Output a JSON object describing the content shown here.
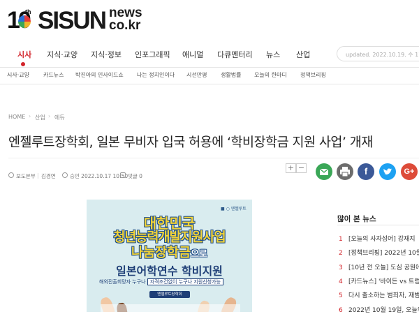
{
  "logo": {
    "ten": "10",
    "th": "th",
    "sisun": "SISUN",
    "news": "news",
    "cokr": "co.kr"
  },
  "main_nav": [
    "시사",
    "지식·교양",
    "지식·정보",
    "인포그래픽",
    "애니멀",
    "다큐멘터리",
    "뉴스",
    "산업"
  ],
  "updated": "updated. 2022.10.19. 수 17:30",
  "sub_nav": [
    "시사·교양",
    "카드뉴스",
    "박진아의 인사이드쇼",
    "나는 정치인이다",
    "시선만평",
    "생활법률",
    "오늘의 한마디",
    "정책브리핑"
  ],
  "breadcrumb": [
    "HOME",
    "산업",
    "에듀"
  ],
  "headline": "엔젤루트장학회, 일본 무비자 입국 허용에 ‘학비장학금 지원 사업’ 개재",
  "meta": {
    "author": "보도본부",
    "reporter": "김경연",
    "date": "승인 2022.10.17 10:50",
    "comments": "댓글 0"
  },
  "font_buttons": {
    "plus": "+",
    "minus": "−"
  },
  "share_icons": [
    {
      "name": "email-icon",
      "color": "#3aa757"
    },
    {
      "name": "print-icon",
      "color": "#6d6d6d"
    },
    {
      "name": "facebook-icon",
      "color": "#3b5998"
    },
    {
      "name": "twitter-icon",
      "color": "#1da1f2"
    },
    {
      "name": "google-plus-icon",
      "color": "#dd4b39"
    }
  ],
  "poster": {
    "logos": "■ ○ 엔젤루트",
    "line1": "대한민국",
    "line2": "청년능력개발지원사업",
    "line3": "나눔장학금",
    "line3_suffix": "으로",
    "line4": "일본어학연수 학비지원",
    "pill_left": "해외진출희망자 누구나",
    "pill_right": "자격조건없이 누구나 지원신청가능",
    "pill_bottom": "엔젤루트장학회"
  },
  "sidebar": {
    "title": "많이 본 뉴스",
    "items": [
      {
        "num": "1",
        "text": "[오늘의 사자성어] 강재지"
      },
      {
        "num": "2",
        "text": "[정책브리핑] 2022년 10월"
      },
      {
        "num": "3",
        "text": "[10년 전 오늘] 도심 공원에"
      },
      {
        "num": "4",
        "text": "[카드뉴스] '바이든 vs 트럼"
      },
      {
        "num": "5",
        "text": "다시 출소하는 범죄자, 재범"
      },
      {
        "num": "6",
        "text": "2022년 10월 19일, 오늘의"
      }
    ]
  },
  "colors": {
    "accent": "#d2232a",
    "poster_bg": "#d9ecef",
    "poster_yellow": "#f2d339",
    "poster_navy": "#1f3f77"
  }
}
